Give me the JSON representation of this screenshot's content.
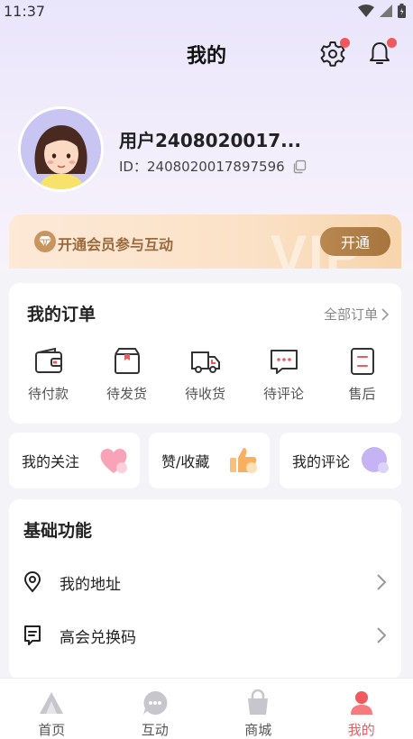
{
  "status_bar": {
    "time": "11:37"
  },
  "header": {
    "title": "我的"
  },
  "profile": {
    "username": "用户2408020017...",
    "id_label": "ID：",
    "id_value": "2408020017897596"
  },
  "vip": {
    "promo_text": "开通会员参与互动",
    "button_label": "开通",
    "watermark": "VIP"
  },
  "orders": {
    "title": "我的订单",
    "all_label": "全部订单",
    "items": [
      {
        "label": "待付款",
        "icon": "wallet-icon"
      },
      {
        "label": "待发货",
        "icon": "package-icon"
      },
      {
        "label": "待收货",
        "icon": "truck-icon"
      },
      {
        "label": "待评论",
        "icon": "comment-icon"
      },
      {
        "label": "售后",
        "icon": "after-sale-icon"
      }
    ]
  },
  "shortcuts": [
    {
      "label": "我的关注",
      "icon": "heart-icon"
    },
    {
      "label": "赞/收藏",
      "icon": "thumbs-up-icon"
    },
    {
      "label": "我的评论",
      "icon": "chat-bubble-icon"
    }
  ],
  "basic": {
    "title": "基础功能",
    "items": [
      {
        "label": "我的地址",
        "icon": "location-pin-icon"
      },
      {
        "label": "高会兑换码",
        "icon": "redeem-code-icon"
      }
    ]
  },
  "tabbar": {
    "items": [
      {
        "label": "首页",
        "icon": "home-icon"
      },
      {
        "label": "互动",
        "icon": "chat-icon"
      },
      {
        "label": "商城",
        "icon": "shopping-bag-icon"
      },
      {
        "label": "我的",
        "icon": "person-icon"
      }
    ],
    "active_index": 3
  },
  "colors": {
    "accent": "#f05a5e",
    "vip_gold": "#a6743e",
    "notification_dot": "#f0595c"
  }
}
